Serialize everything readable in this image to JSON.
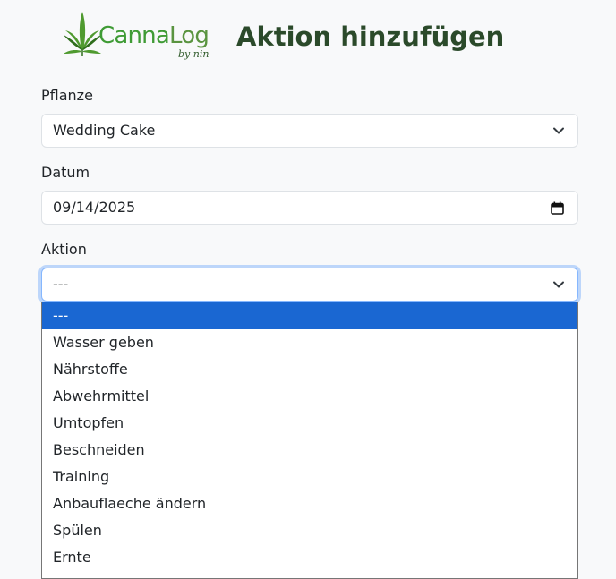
{
  "header": {
    "logo_part1": "Canna",
    "logo_part2": "Log",
    "logo_byline": "by nin",
    "title": "Aktion hinzufügen"
  },
  "form": {
    "plant": {
      "label": "Pflanze",
      "value": "Wedding Cake"
    },
    "date": {
      "label": "Datum",
      "value": "09/14/2025"
    },
    "action": {
      "label": "Aktion",
      "value": "---",
      "options": [
        "---",
        "Wasser geben",
        "Nährstoffe",
        "Abwehrmittel",
        "Umtopfen",
        "Beschneiden",
        "Training",
        "Anbauflaeche ändern",
        "Spülen",
        "Ernte"
      ],
      "selected_index": 0
    }
  },
  "colors": {
    "title": "#2b4a2a",
    "logo_green": "#3f9b35",
    "focus_border": "#86b7fe",
    "option_highlight": "#1a67d2",
    "page_background": "#f8f9fa"
  },
  "icons": {
    "logo": "cannabis-leaf-icon",
    "select_arrow": "chevron-down-icon",
    "date_picker": "calendar-icon"
  }
}
